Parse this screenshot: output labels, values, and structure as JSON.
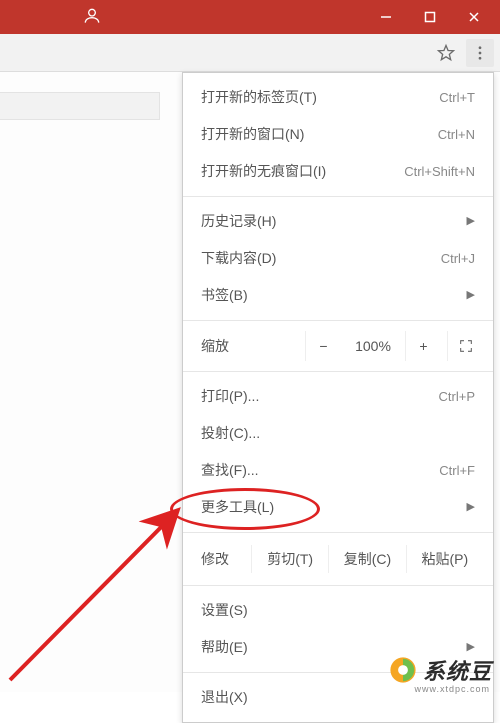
{
  "titlebar": {
    "minimize": "—",
    "maximize": "❐",
    "close": "✕"
  },
  "menu": {
    "new_tab": {
      "label": "打开新的标签页(T)",
      "shortcut": "Ctrl+T"
    },
    "new_window": {
      "label": "打开新的窗口(N)",
      "shortcut": "Ctrl+N"
    },
    "new_incognito": {
      "label": "打开新的无痕窗口(I)",
      "shortcut": "Ctrl+Shift+N"
    },
    "history": {
      "label": "历史记录(H)"
    },
    "downloads": {
      "label": "下载内容(D)",
      "shortcut": "Ctrl+J"
    },
    "bookmarks": {
      "label": "书签(B)"
    },
    "zoom": {
      "label": "缩放",
      "value": "100%",
      "minus": "−",
      "plus": "+"
    },
    "print": {
      "label": "打印(P)...",
      "shortcut": "Ctrl+P"
    },
    "cast": {
      "label": "投射(C)..."
    },
    "find": {
      "label": "查找(F)...",
      "shortcut": "Ctrl+F"
    },
    "more_tools": {
      "label": "更多工具(L)"
    },
    "edit": {
      "label": "修改",
      "cut": "剪切(T)",
      "copy": "复制(C)",
      "paste": "粘贴(P)"
    },
    "settings": {
      "label": "设置(S)"
    },
    "help": {
      "label": "帮助(E)"
    },
    "exit": {
      "label": "退出(X)"
    }
  },
  "watermark": {
    "text": "系统豆",
    "url": "www.xtdpc.com"
  }
}
